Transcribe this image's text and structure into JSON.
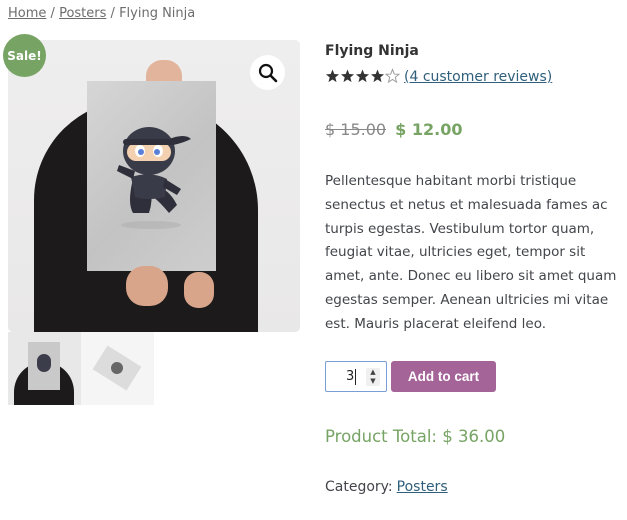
{
  "breadcrumb": {
    "home": "Home",
    "sep1": "/",
    "category": "Posters",
    "sep2": "/",
    "current": "Flying Ninja"
  },
  "gallery": {
    "badge": "Sale!",
    "zoom_icon": "search-icon"
  },
  "product": {
    "title": "Flying Ninja",
    "rating_value": 4,
    "rating_max": 5,
    "reviews_link": "(4 customer reviews)",
    "price_old": "$ 15.00",
    "price_new": "$ 12.00",
    "description": "Pellentesque habitant morbi tristique senectus et netus et malesuada fames ac turpis egestas. Vestibulum tortor quam, feugiat vitae, ultricies eget, tempor sit amet, ante. Donec eu libero sit amet quam egestas semper. Aenean ultricies mi vitae est. Mauris placerat eleifend leo.",
    "quantity": "3",
    "add_to_cart": "Add to cart",
    "total": "Product Total: $ 36.00",
    "category_label": "Category:",
    "category_link": "Posters"
  },
  "colors": {
    "accent": "#a46497",
    "sale_green": "#77a464",
    "link": "#2f5f7c",
    "star": "#333333"
  }
}
